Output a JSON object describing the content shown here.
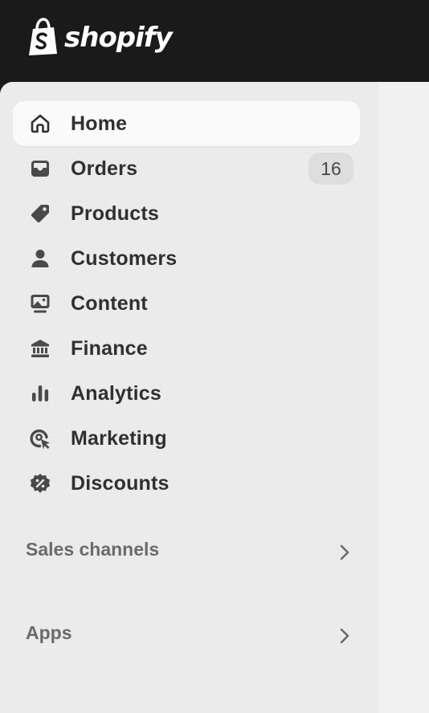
{
  "brand": {
    "name": "shopify",
    "logo_icon": "shopping-bag-icon",
    "topbar_color": "#1a1a1a"
  },
  "sidebar": {
    "items": [
      {
        "label": "Home",
        "icon": "home-icon",
        "active": true
      },
      {
        "label": "Orders",
        "icon": "inbox-icon",
        "badge": "16"
      },
      {
        "label": "Products",
        "icon": "tag-icon"
      },
      {
        "label": "Customers",
        "icon": "person-icon"
      },
      {
        "label": "Content",
        "icon": "image-icon"
      },
      {
        "label": "Finance",
        "icon": "bank-icon"
      },
      {
        "label": "Analytics",
        "icon": "bar-chart-icon"
      },
      {
        "label": "Marketing",
        "icon": "target-icon"
      },
      {
        "label": "Discounts",
        "icon": "discount-icon"
      }
    ],
    "sections": [
      {
        "label": "Sales channels",
        "icon": "chevron-right-icon"
      },
      {
        "label": "Apps",
        "icon": "chevron-right-icon"
      }
    ]
  },
  "colors": {
    "sidebar_bg": "#ebebeb",
    "active_item_bg": "#fafafa",
    "text": "#303030",
    "muted_text": "#6b6b6b",
    "badge_bg": "#dedede"
  }
}
